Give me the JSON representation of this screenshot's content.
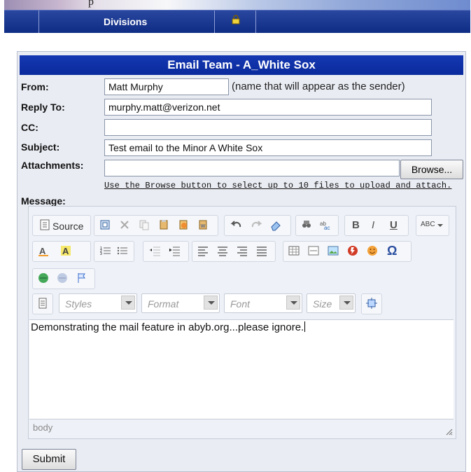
{
  "nav": {
    "top_text": "p",
    "divisions_label": "Divisions"
  },
  "form": {
    "title": "Email Team - A_White Sox",
    "from_label": "From:",
    "from_value": "Matt Murphy",
    "from_hint": "(name that will appear as the sender)",
    "reply_to_label": "Reply To:",
    "reply_to_value": "murphy.matt@verizon.net",
    "cc_label": "CC:",
    "cc_value": "",
    "subject_label": "Subject:",
    "subject_value": "Test email to the Minor A White Sox",
    "attachments_label": "Attachments:",
    "attachments_value": "",
    "browse_label": "Browse...",
    "browse_note": "Use the Browse button to select up to 10 files to upload and attach.",
    "message_label": "Message:",
    "submit_label": "Submit"
  },
  "editor": {
    "source_label": "Source",
    "styles": "Styles",
    "format": "Format",
    "font": "Font",
    "size": "Size",
    "bold": "B",
    "italic": "I",
    "underline": "U",
    "omega": "Ω",
    "spell_label": "ABC",
    "content": "Demonstrating the mail feature in abyb.org...please ignore.",
    "status": "body"
  },
  "colors": {
    "header_blue": "#0a2a9c",
    "nav_blue": "#0f2c84"
  }
}
